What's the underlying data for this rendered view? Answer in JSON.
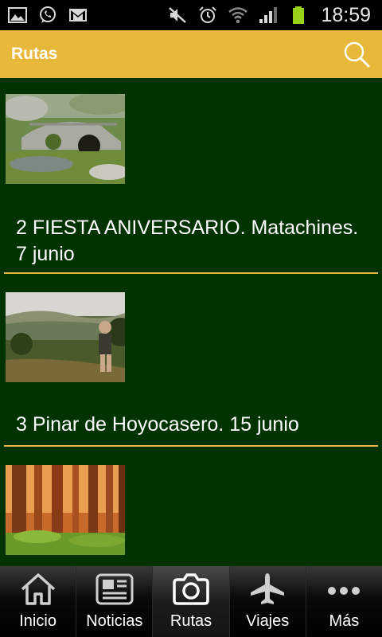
{
  "status_bar": {
    "time": "18:59",
    "left_icons": [
      "gallery-icon",
      "whatsapp-icon",
      "gmail-icon"
    ],
    "right_icons": [
      "mute-icon",
      "alarm-icon",
      "wifi-icon",
      "signal-icon",
      "battery-icon"
    ]
  },
  "appbar": {
    "title": "Rutas",
    "search_icon": "search-icon"
  },
  "routes": [
    {
      "title": "2 FIESTA ANIVERSARIO. Matachines. 7 junio",
      "thumbnail": "stone-bridge-photo"
    },
    {
      "title": "3 Pinar de Hoyocasero. 15 junio",
      "thumbnail": "hiker-valley-photo"
    },
    {
      "title": "",
      "thumbnail": "pine-forest-photo"
    }
  ],
  "bottom_nav": {
    "items": [
      {
        "label": "Inicio",
        "icon": "home-icon"
      },
      {
        "label": "Noticias",
        "icon": "newspaper-icon"
      },
      {
        "label": "Rutas",
        "icon": "camera-icon",
        "active": true
      },
      {
        "label": "Viajes",
        "icon": "airplane-icon"
      },
      {
        "label": "Más",
        "icon": "more-icon"
      }
    ]
  },
  "colors": {
    "accent": "#e8b83a",
    "background": "#003300",
    "statusbar": "#000000"
  }
}
